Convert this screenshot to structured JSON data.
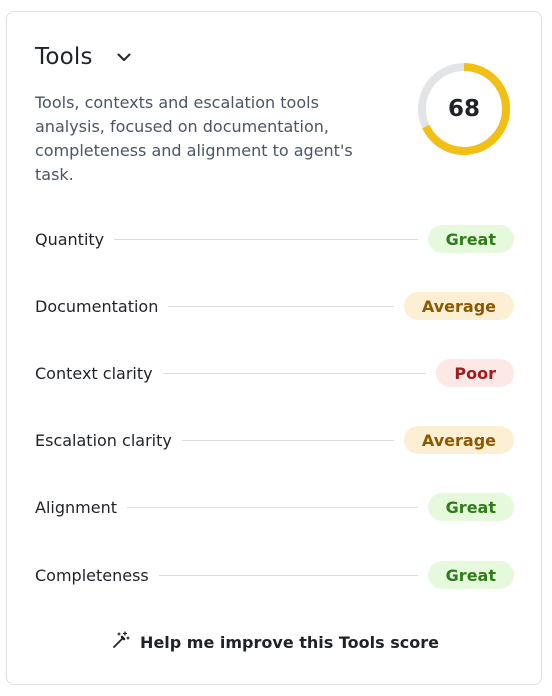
{
  "card": {
    "title": "Tools",
    "description": "Tools, contexts and escalation tools analysis, focused on documentation, completeness and alignment to agent's task.",
    "score": "68",
    "score_fraction": 0.68
  },
  "colors": {
    "gauge_fill": "#f2c014",
    "gauge_track": "#e3e4e6",
    "great_bg": "#e6f9dd",
    "great_text": "#2f7d1a",
    "average_bg": "#fcefd4",
    "average_text": "#8a5a00",
    "poor_bg": "#fde8e8",
    "poor_text": "#a11d1d"
  },
  "metrics": [
    {
      "label": "Quantity",
      "rating": "Great"
    },
    {
      "label": "Documentation",
      "rating": "Average"
    },
    {
      "label": "Context clarity",
      "rating": "Poor"
    },
    {
      "label": "Escalation clarity",
      "rating": "Average"
    },
    {
      "label": "Alignment",
      "rating": "Great"
    },
    {
      "label": "Completeness",
      "rating": "Great"
    }
  ],
  "help": {
    "label": "Help me improve this Tools score",
    "icon": "magic-wand-icon"
  }
}
